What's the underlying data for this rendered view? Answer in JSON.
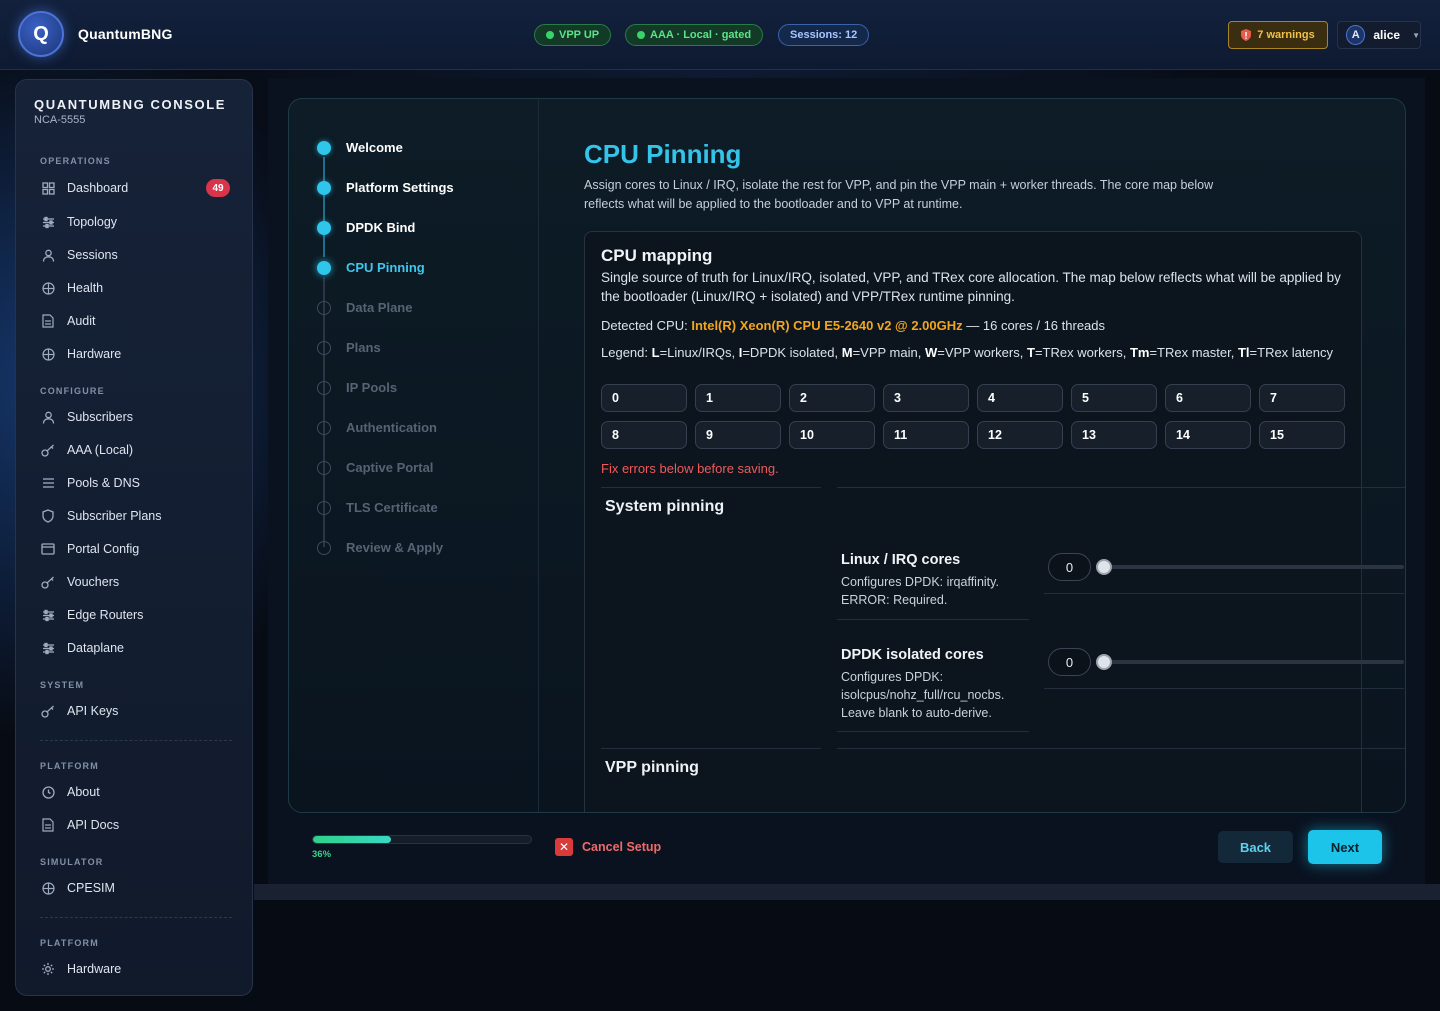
{
  "topbar": {
    "logo_letter": "Q",
    "brand": "QuantumBNG",
    "status_vpp": "VPP UP",
    "status_aaa": "AAA · Local · gated",
    "sessions": "Sessions: 12",
    "warnings": "7 warnings",
    "user_initial": "A",
    "user_name": "alice"
  },
  "sidebar": {
    "title": "QUANTUMBNG CONSOLE",
    "subtitle": "NCA-5555",
    "sections": {
      "operations": "OPERATIONS",
      "configure": "CONFIGURE",
      "system": "SYSTEM",
      "platform": "PLATFORM",
      "simulator": "SIMULATOR",
      "platform2": "PLATFORM"
    },
    "items": {
      "dashboard": "Dashboard",
      "dashboard_badge": "49",
      "topology": "Topology",
      "sessions": "Sessions",
      "health": "Health",
      "audit": "Audit",
      "hardware": "Hardware",
      "subscribers": "Subscribers",
      "aaa_local": "AAA (Local)",
      "pools_dns": "Pools & DNS",
      "subscriber_plans": "Subscriber Plans",
      "portal_config": "Portal Config",
      "vouchers": "Vouchers",
      "edge_routers": "Edge Routers",
      "dataplane": "Dataplane",
      "api_keys": "API Keys",
      "about": "About",
      "api_docs": "API Docs",
      "cpesim": "CPESIM",
      "hardware2": "Hardware"
    }
  },
  "wizard": {
    "steps": [
      {
        "label": "Welcome",
        "state": "done"
      },
      {
        "label": "Platform Settings",
        "state": "done"
      },
      {
        "label": "DPDK Bind",
        "state": "done"
      },
      {
        "label": "CPU Pinning",
        "state": "active"
      },
      {
        "label": "Data Plane",
        "state": "todo"
      },
      {
        "label": "Plans",
        "state": "todo"
      },
      {
        "label": "IP Pools",
        "state": "todo"
      },
      {
        "label": "Authentication",
        "state": "todo"
      },
      {
        "label": "Captive Portal",
        "state": "todo"
      },
      {
        "label": "TLS Certificate",
        "state": "todo"
      },
      {
        "label": "Review & Apply",
        "state": "todo"
      }
    ],
    "title": "CPU Pinning",
    "description": "Assign cores to Linux / IRQ, isolate the rest for VPP, and pin the VPP main + worker threads. The core map below reflects what will be applied to the bootloader and to VPP at runtime.",
    "cpu_mapping": {
      "title": "CPU mapping",
      "description": "Single source of truth for Linux/IRQ, isolated, VPP, and TRex core allocation. The map below reflects what will be applied by the bootloader (Linux/IRQ + isolated) and VPP/TRex runtime pinning.",
      "detected_prefix": "Detected CPU:",
      "detected_cpu": "Intel(R) Xeon(R) CPU E5-2640 v2 @ 2.00GHz",
      "detected_suffix": "— 16 cores / 16 threads",
      "legend_label": "Legend:",
      "legend": [
        {
          "key": "L",
          "desc": "=Linux/IRQs,"
        },
        {
          "key": "I",
          "desc": "=DPDK isolated,"
        },
        {
          "key": "M",
          "desc": "=VPP main,"
        },
        {
          "key": "W",
          "desc": "=VPP workers,"
        },
        {
          "key": "T",
          "desc": "=TRex workers,"
        },
        {
          "key": "Tm",
          "desc": "=TRex master,"
        },
        {
          "key": "Tl",
          "desc": "=TRex latency"
        }
      ],
      "cores": [
        "0",
        "1",
        "2",
        "3",
        "4",
        "5",
        "6",
        "7",
        "8",
        "9",
        "10",
        "11",
        "12",
        "13",
        "14",
        "15"
      ],
      "error": "Fix errors below before saving."
    },
    "system_pinning": {
      "title": "System pinning",
      "linux_irq": {
        "label": "Linux / IRQ cores",
        "desc": "Configures DPDK: irqaffinity. ERROR: Required.",
        "value": "0"
      },
      "dpdk_isolated": {
        "label": "DPDK isolated cores",
        "desc": "Configures DPDK: isolcpus/nohz_full/rcu_nocbs. Leave blank to auto-derive.",
        "value": "0"
      }
    },
    "vpp_pinning": {
      "title": "VPP pinning"
    }
  },
  "footer": {
    "progress": 0.36,
    "progress_label": "36%",
    "cancel": "Cancel Setup",
    "back": "Back",
    "next": "Next"
  },
  "colors": {
    "accent": "#1dc4ea",
    "error": "#ef5a5a",
    "cpu_highlight": "#f2a51f",
    "status_green": "#5ee38a"
  }
}
